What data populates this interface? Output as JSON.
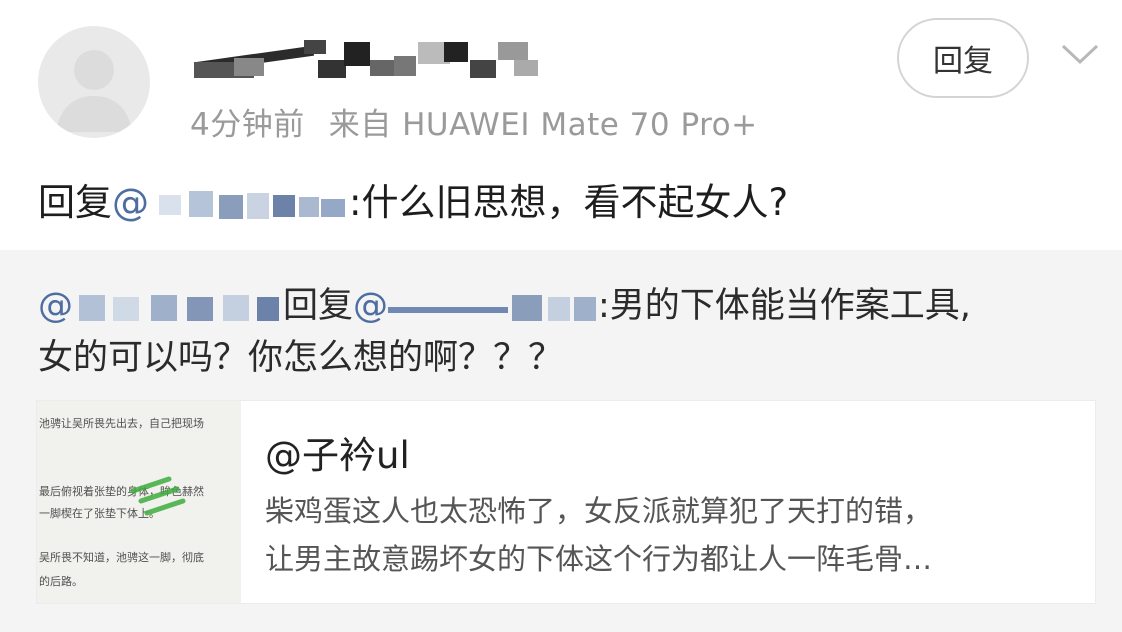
{
  "comment": {
    "username": "",
    "time": "4分钟前",
    "source": "来自 HUAWEI Mate 70 Pro+",
    "reply_button": "回复",
    "reply_prefix": "回复",
    "reply_at": "@",
    "reply_mention_tail": "",
    "reply_text": ":什么旧思想，看不起女人?"
  },
  "quote": {
    "mention_start": "@",
    "reply_word": "回复",
    "mention2_start": "@",
    "text_line1": ":男的下体能当作案工具,",
    "text_line2": "女的可以吗？你怎么想的啊？？？"
  },
  "card": {
    "title": "@子衿ul",
    "desc_line1": "柴鸡蛋这人也太恐怖了，女反派就算犯了天打的错，",
    "desc_line2": "让男主故意踢坏女的下体这个行为都让人一阵毛骨…",
    "thumb_lines": [
      "池骋让吴所畏先出去，自己把现场",
      "最后俯视着张垫的身体，眸色赫然",
      "一脚楔在了张垫下体上。",
      "吴所畏不知道，池骋这一脚，彻底",
      "的后路。"
    ]
  }
}
